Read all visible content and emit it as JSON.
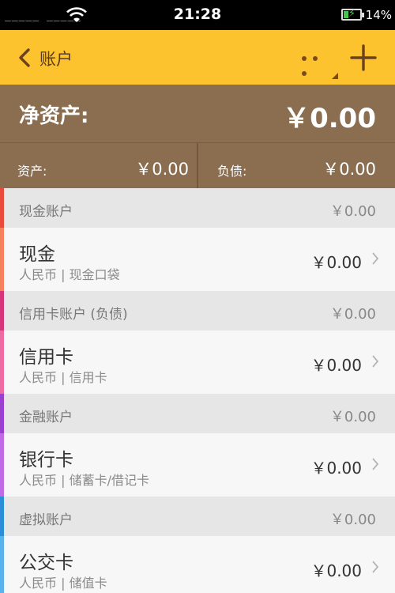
{
  "status": {
    "signal": "_____ _____",
    "time": "21:28",
    "battery_pct": "14%"
  },
  "appbar": {
    "title": "账户"
  },
  "networth": {
    "label": "净资产:",
    "value": "￥0.00"
  },
  "summary": {
    "assets_label": "资产:",
    "assets_value": "￥0.00",
    "liab_label": "负债:",
    "liab_value": "￥0.00"
  },
  "groups": [
    {
      "name": "现金账户",
      "amount": "￥0.00",
      "color": "#e84a3c",
      "accounts": [
        {
          "name": "现金",
          "sub": "人民币 | 现金口袋",
          "amount": "￥0.00",
          "color": "#f5825d"
        }
      ]
    },
    {
      "name": "信用卡账户 (负债)",
      "amount": "￥0.00",
      "color": "#d6357a",
      "accounts": [
        {
          "name": "信用卡",
          "sub": "人民币 | 信用卡",
          "amount": "￥0.00",
          "color": "#ee6aa3"
        }
      ]
    },
    {
      "name": "金融账户",
      "amount": "￥0.00",
      "color": "#9b3fd0",
      "accounts": [
        {
          "name": "银行卡",
          "sub": "人民币 | 储蓄卡/借记卡",
          "amount": "￥0.00",
          "color": "#c06ae6"
        }
      ]
    },
    {
      "name": "虚拟账户",
      "amount": "￥0.00",
      "color": "#2a8fd6",
      "accounts": [
        {
          "name": "公交卡",
          "sub": "人民币 | 储值卡",
          "amount": "￥0.00",
          "color": "#5ab3ec"
        }
      ]
    }
  ]
}
